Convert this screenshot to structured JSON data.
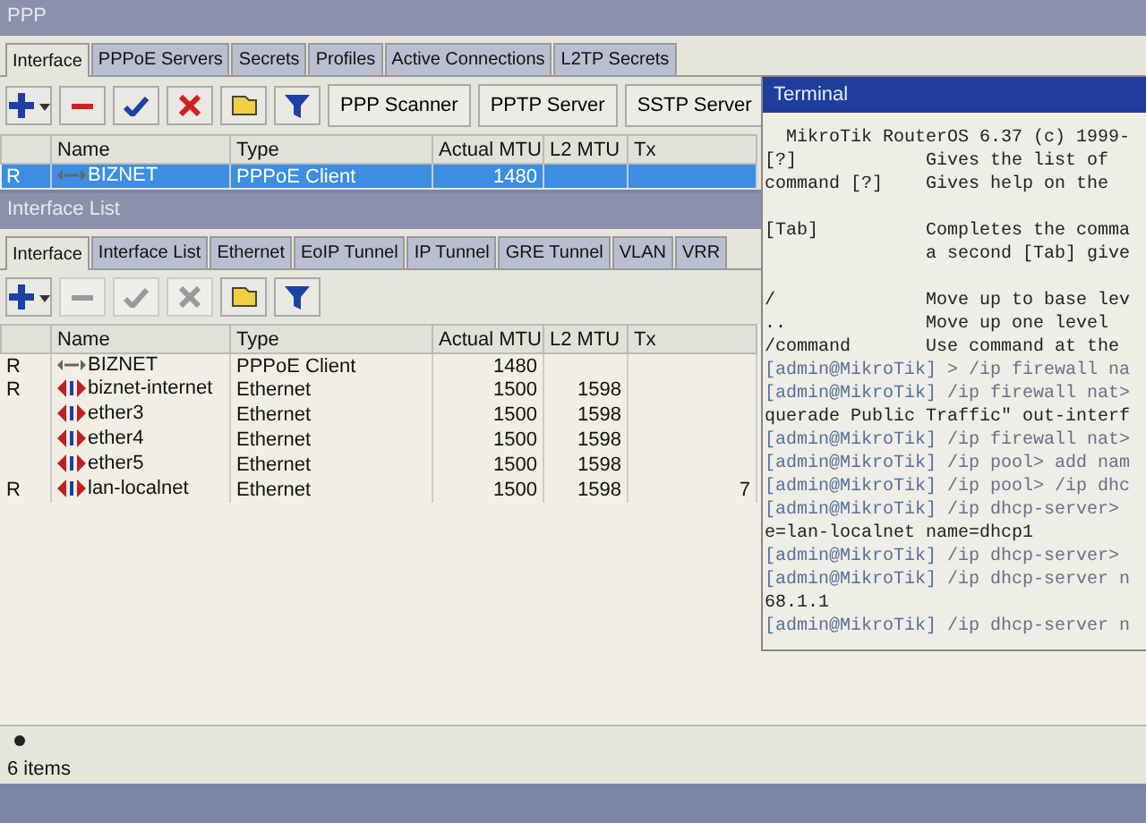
{
  "ppp_window": {
    "title": "PPP",
    "tabs": [
      {
        "label": "Interface",
        "selected": true
      },
      {
        "label": "PPPoE Servers",
        "selected": false
      },
      {
        "label": "Secrets",
        "selected": false
      },
      {
        "label": "Profiles",
        "selected": false
      },
      {
        "label": "Active Connections",
        "selected": false
      },
      {
        "label": "L2TP Secrets",
        "selected": false
      }
    ],
    "toolbar": [
      {
        "kind": "add",
        "disabled": false
      },
      {
        "kind": "remove",
        "disabled": false
      },
      {
        "kind": "enable",
        "disabled": false
      },
      {
        "kind": "disable",
        "disabled": false
      },
      {
        "kind": "comment",
        "disabled": false
      },
      {
        "kind": "filter",
        "disabled": false
      }
    ],
    "buttons": [
      "PPP Scanner",
      "PPTP Server",
      "SSTP Server"
    ],
    "columns": [
      "Name",
      "Type",
      "Actual MTU",
      "L2 MTU",
      "Tx"
    ],
    "rows": [
      {
        "flag": "R",
        "kind": "ppp",
        "name": "BIZNET",
        "type": "PPPoE Client",
        "actual_mtu": "1480",
        "selected": true
      }
    ]
  },
  "interface_window": {
    "title": "Interface List",
    "tabs": [
      {
        "label": "Interface",
        "selected": true
      },
      {
        "label": "Interface List",
        "selected": false
      },
      {
        "label": "Ethernet",
        "selected": false
      },
      {
        "label": "EoIP Tunnel",
        "selected": false
      },
      {
        "label": "IP Tunnel",
        "selected": false
      },
      {
        "label": "GRE Tunnel",
        "selected": false
      },
      {
        "label": "VLAN",
        "selected": false
      },
      {
        "label": "VRR",
        "selected": false
      }
    ],
    "toolbar": [
      {
        "kind": "add",
        "disabled": false
      },
      {
        "kind": "remove",
        "disabled": true
      },
      {
        "kind": "enable",
        "disabled": true
      },
      {
        "kind": "disable",
        "disabled": true
      },
      {
        "kind": "comment",
        "disabled": false
      },
      {
        "kind": "filter",
        "disabled": false
      }
    ],
    "columns": [
      "Name",
      "Type",
      "Actual MTU",
      "L2 MTU",
      "Tx"
    ],
    "rows": [
      {
        "flag": "R",
        "kind": "ppp",
        "name": "BIZNET",
        "type": "PPPoE Client",
        "actual_mtu": "1480"
      },
      {
        "flag": "R",
        "kind": "ethernet",
        "name": "biznet-internet",
        "type": "Ethernet",
        "actual_mtu": "1500",
        "l2_mtu": "1598"
      },
      {
        "kind": "ethernet",
        "name": "ether3",
        "type": "Ethernet",
        "actual_mtu": "1500",
        "l2_mtu": "1598"
      },
      {
        "kind": "ethernet",
        "name": "ether4",
        "type": "Ethernet",
        "actual_mtu": "1500",
        "l2_mtu": "1598"
      },
      {
        "kind": "ethernet",
        "name": "ether5",
        "type": "Ethernet",
        "actual_mtu": "1500",
        "l2_mtu": "1598"
      },
      {
        "flag": "R",
        "kind": "ethernet",
        "name": "lan-localnet",
        "type": "Ethernet",
        "actual_mtu": "1500",
        "l2_mtu": "1598",
        "tx": "7"
      }
    ],
    "status": "6 items"
  },
  "terminal": {
    "title": "Terminal",
    "lines": [
      {
        "kind": "banner",
        "text": "MikroTik RouterOS 6.37 (c) 1999-"
      },
      {
        "kind": "help",
        "key": "[?]",
        "text": "Gives the list of"
      },
      {
        "kind": "help",
        "key": "command [?]",
        "text": "Gives help on the"
      },
      {
        "kind": "gap"
      },
      {
        "kind": "help",
        "key": "[Tab]",
        "text": "Completes the comma"
      },
      {
        "kind": "help",
        "text": "a second [Tab] give"
      },
      {
        "kind": "gap"
      },
      {
        "kind": "help",
        "key": "/",
        "text": "Move up to base lev"
      },
      {
        "kind": "help",
        "key": "..",
        "text": "Move up one level"
      },
      {
        "kind": "help",
        "key": "/command",
        "text": "Use command at the"
      },
      {
        "kind": "prompt",
        "prompt": "[admin@MikroTik]",
        "text": "> /ip firewall na"
      },
      {
        "kind": "prompt",
        "prompt": "[admin@MikroTik]",
        "text": "/ip firewall nat>"
      },
      {
        "kind": "output",
        "text": "querade Public Traffic\" out-interf"
      },
      {
        "kind": "prompt",
        "prompt": "[admin@MikroTik]",
        "text": "/ip firewall nat>"
      },
      {
        "kind": "prompt",
        "prompt": "[admin@MikroTik]",
        "text": "/ip pool> add nam"
      },
      {
        "kind": "prompt",
        "prompt": "[admin@MikroTik]",
        "text": "/ip pool> /ip dhc"
      },
      {
        "kind": "prompt",
        "prompt": "[admin@MikroTik]",
        "text": "/ip dhcp-server>"
      },
      {
        "kind": "output",
        "text": "e=lan-localnet name=dhcp1"
      },
      {
        "kind": "prompt",
        "prompt": "[admin@MikroTik]",
        "text": "/ip dhcp-server>"
      },
      {
        "kind": "prompt",
        "prompt": "[admin@MikroTik]",
        "text": "/ip dhcp-server n"
      },
      {
        "kind": "output",
        "text": "68.1.1"
      },
      {
        "kind": "prompt",
        "prompt": "[admin@MikroTik]",
        "text": "/ip dhcp-server n"
      }
    ]
  }
}
